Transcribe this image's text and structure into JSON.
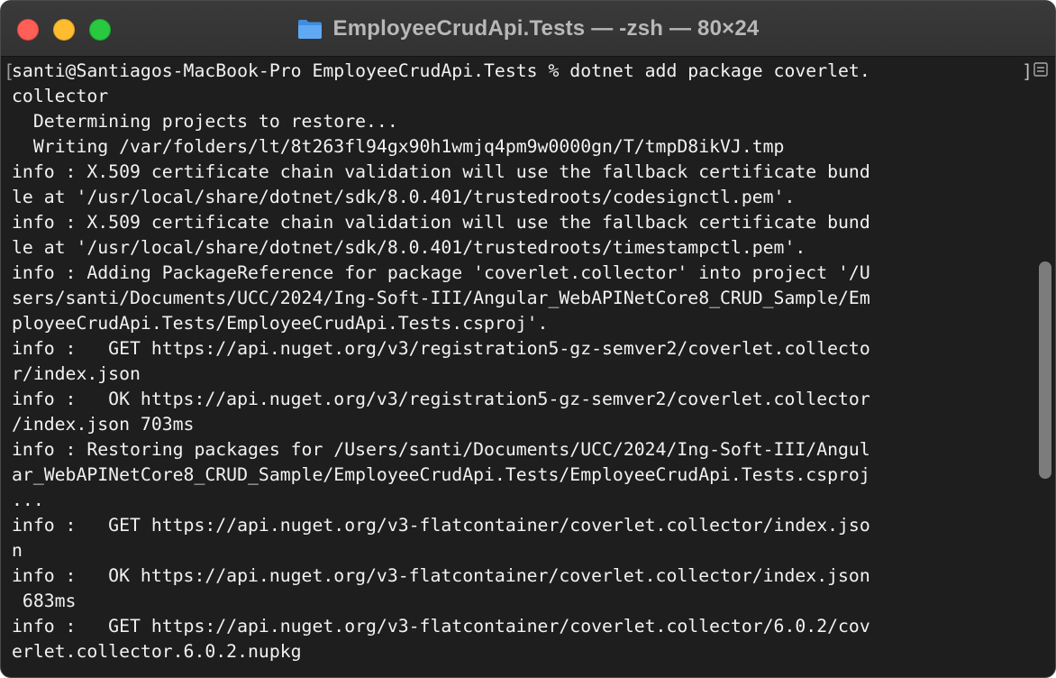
{
  "window": {
    "title": "EmployeeCrudApi.Tests — -zsh — 80×24",
    "folder_icon": "folder-icon"
  },
  "colors": {
    "background": "#1e1e1e",
    "text": "#f2f2f2",
    "close": "#ff5f57",
    "minimize": "#febc2e",
    "maximize": "#28c840"
  },
  "terminal": {
    "lines": [
      "santi@Santiagos-MacBook-Pro EmployeeCrudApi.Tests % dotnet add package coverlet.",
      "collector",
      "  Determining projects to restore...",
      "  Writing /var/folders/lt/8t263fl94gx90h1wmjq4pm9w0000gn/T/tmpD8ikVJ.tmp",
      "info : X.509 certificate chain validation will use the fallback certificate bund",
      "le at '/usr/local/share/dotnet/sdk/8.0.401/trustedroots/codesignctl.pem'.",
      "info : X.509 certificate chain validation will use the fallback certificate bund",
      "le at '/usr/local/share/dotnet/sdk/8.0.401/trustedroots/timestampctl.pem'.",
      "info : Adding PackageReference for package 'coverlet.collector' into project '/U",
      "sers/santi/Documents/UCC/2024/Ing-Soft-III/Angular_WebAPINetCore8_CRUD_Sample/Em",
      "ployeeCrudApi.Tests/EmployeeCrudApi.Tests.csproj'.",
      "info :   GET https://api.nuget.org/v3/registration5-gz-semver2/coverlet.collecto",
      "r/index.json",
      "info :   OK https://api.nuget.org/v3/registration5-gz-semver2/coverlet.collector",
      "/index.json 703ms",
      "info : Restoring packages for /Users/santi/Documents/UCC/2024/Ing-Soft-III/Angul",
      "ar_WebAPINetCore8_CRUD_Sample/EmployeeCrudApi.Tests/EmployeeCrudApi.Tests.csproj",
      "...",
      "info :   GET https://api.nuget.org/v3-flatcontainer/coverlet.collector/index.jso",
      "n",
      "info :   OK https://api.nuget.org/v3-flatcontainer/coverlet.collector/index.json",
      " 683ms",
      "info :   GET https://api.nuget.org/v3-flatcontainer/coverlet.collector/6.0.2/cov",
      "erlet.collector.6.0.2.nupkg"
    ]
  },
  "scrollbar": {
    "thumb_start": 0.3,
    "thumb_end": 0.67,
    "icon": "split-view-icon"
  }
}
